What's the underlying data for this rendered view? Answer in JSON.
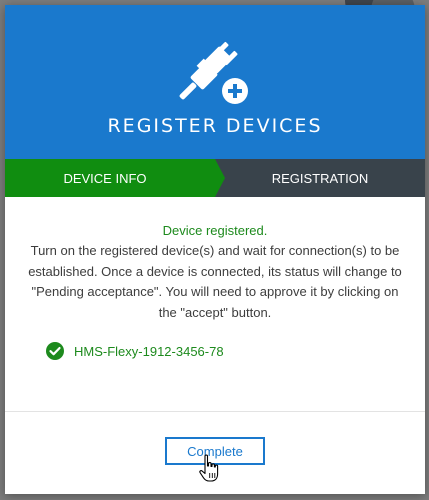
{
  "modal": {
    "title": "REGISTER DEVICES",
    "header_icon": "plug-connect-add-icon",
    "steps": [
      {
        "label": "DEVICE INFO",
        "state": "active"
      },
      {
        "label": "REGISTRATION",
        "state": "inactive"
      }
    ],
    "status": "Device registered.",
    "instructions": "Turn on the registered device(s) and wait for connection(s) to be established. Once a device is connected, its status will change to \"Pending acceptance\". You will need to approve it by clicking on the \"accept\" button.",
    "devices": [
      {
        "name": "HMS-Flexy-1912-3456-78",
        "icon": "check-circle-icon"
      }
    ],
    "complete_label": "Complete"
  },
  "colors": {
    "header_blue": "#1a79cd",
    "step_active_green": "#108d10",
    "step_inactive_dark": "#39434b",
    "success_green": "#1d8a1d"
  }
}
